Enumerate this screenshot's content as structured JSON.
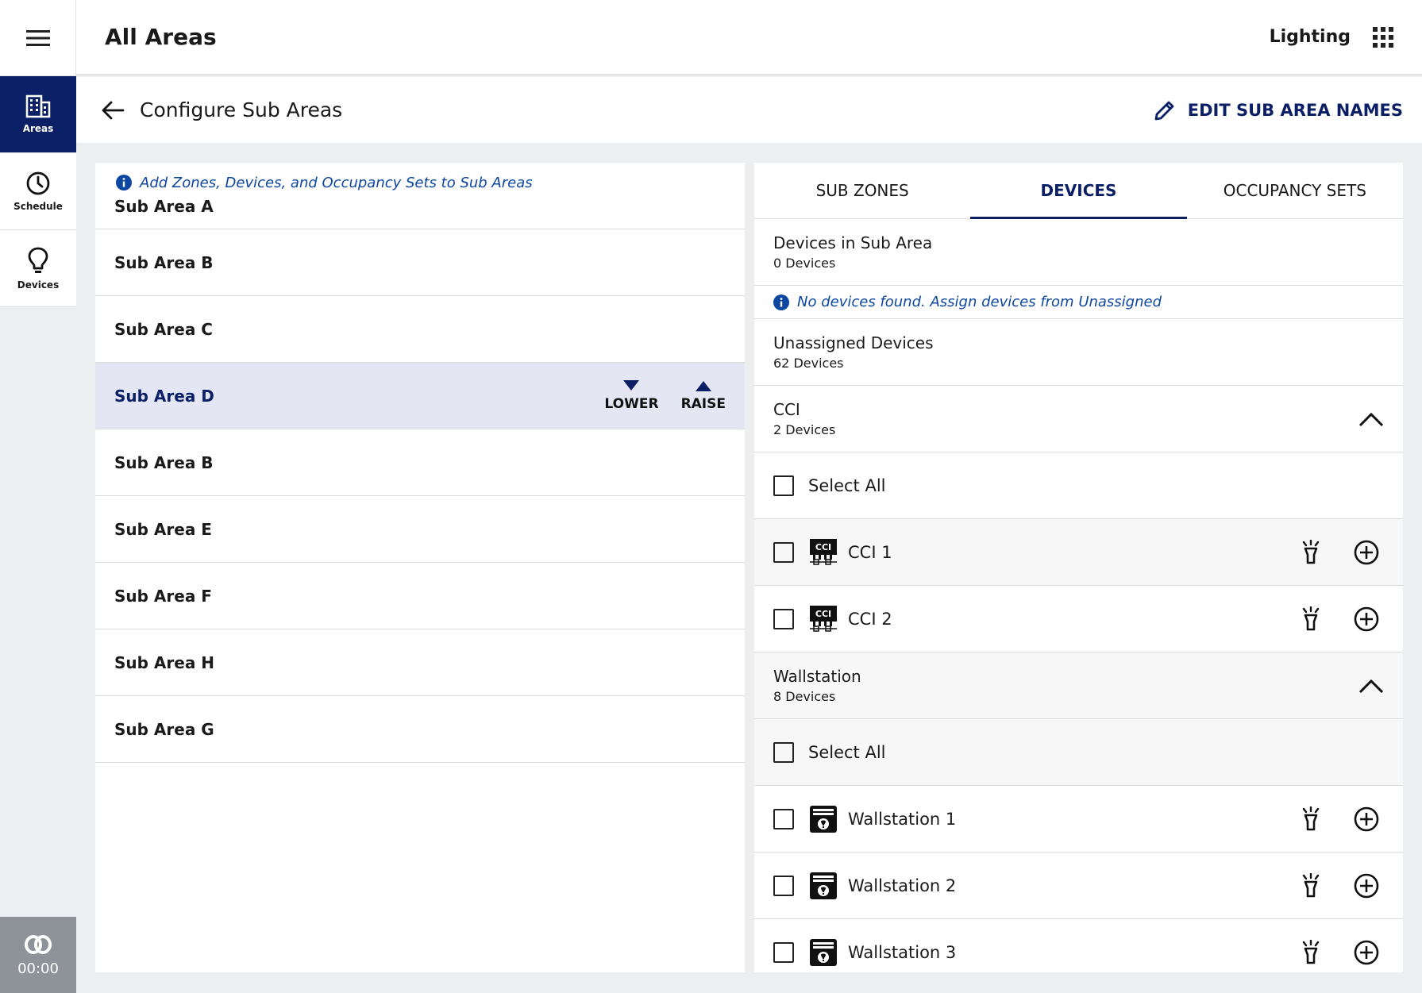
{
  "header": {
    "title": "All Areas",
    "context": "Lighting"
  },
  "rail": {
    "items": [
      {
        "label": "Areas"
      },
      {
        "label": "Schedule"
      },
      {
        "label": "Devices"
      }
    ],
    "timer": "00:00"
  },
  "subheader": {
    "title": "Configure Sub Areas",
    "edit_label": "EDIT SUB AREA NAMES"
  },
  "left": {
    "hint": "Add Zones, Devices, and Occupancy Sets to Sub Areas",
    "sub_areas": [
      "Sub Area A",
      "Sub Area B",
      "Sub Area C",
      "Sub Area D",
      "Sub Area B",
      "Sub Area E",
      "Sub Area F",
      "Sub Area H",
      "Sub Area G"
    ],
    "selected_index": 3,
    "lower_label": "LOWER",
    "raise_label": "RAISE"
  },
  "right": {
    "tabs": [
      "SUB ZONES",
      "DEVICES",
      "OCCUPANCY SETS"
    ],
    "active_tab": 1,
    "in_sub_area": {
      "title": "Devices in Sub Area",
      "count": "0 Devices"
    },
    "empty_hint": "No devices found. Assign devices from Unassigned",
    "unassigned": {
      "title": "Unassigned Devices",
      "count": "62 Devices"
    },
    "select_all_label": "Select All",
    "groups": [
      {
        "name": "CCI",
        "count": "2 Devices",
        "icon": "cci-device-icon",
        "devices": [
          "CCI 1",
          "CCI 2"
        ]
      },
      {
        "name": "Wallstation",
        "count": "8 Devices",
        "icon": "wallstation-icon",
        "devices": [
          "Wallstation 1",
          "Wallstation 2",
          "Wallstation 3"
        ]
      }
    ]
  },
  "colors": {
    "brand": "#0b1f66",
    "info": "#0d47a1",
    "selected_row": "#e4e7f3"
  }
}
